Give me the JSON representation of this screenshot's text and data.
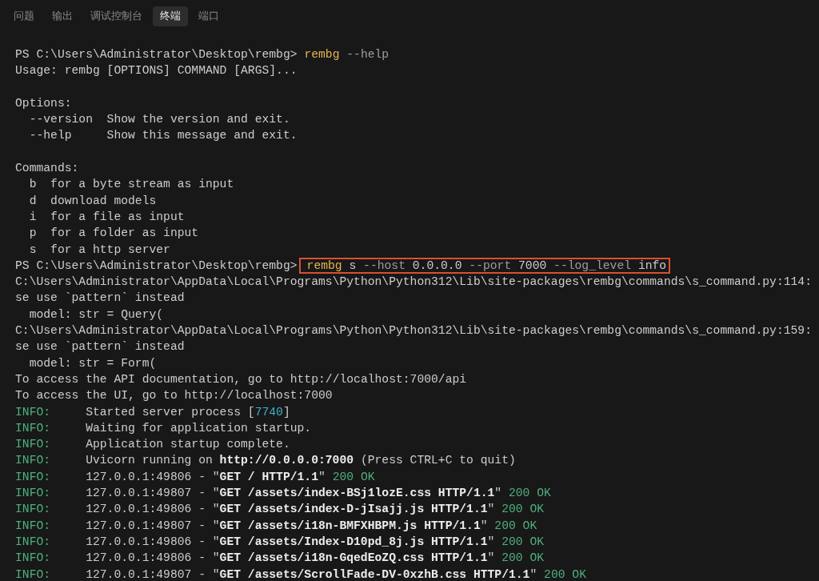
{
  "tabs": [
    {
      "label": "问题",
      "selected": false
    },
    {
      "label": "输出",
      "selected": false
    },
    {
      "label": "调试控制台",
      "selected": false
    },
    {
      "label": "终端",
      "selected": true
    },
    {
      "label": "端口",
      "selected": false
    }
  ],
  "terminal": {
    "lines": [
      {
        "kind": "prompt",
        "prompt": "PS C:\\Users\\Administrator\\Desktop\\rembg>",
        "highlighted": false,
        "segments": [
          {
            "text": " rembg",
            "kind": "command"
          },
          {
            "text": " --help",
            "kind": "flag"
          }
        ]
      },
      {
        "kind": "text",
        "text": "Usage: rembg [OPTIONS] COMMAND [ARGS]..."
      },
      {
        "kind": "blank"
      },
      {
        "kind": "text",
        "text": "Options:"
      },
      {
        "kind": "text",
        "text": "  --version  Show the version and exit."
      },
      {
        "kind": "text",
        "text": "  --help     Show this message and exit."
      },
      {
        "kind": "blank"
      },
      {
        "kind": "text",
        "text": "Commands:"
      },
      {
        "kind": "text",
        "text": "  b  for a byte stream as input"
      },
      {
        "kind": "text",
        "text": "  d  download models"
      },
      {
        "kind": "text",
        "text": "  i  for a file as input"
      },
      {
        "kind": "text",
        "text": "  p  for a folder as input"
      },
      {
        "kind": "text",
        "text": "  s  for a http server"
      },
      {
        "kind": "prompt",
        "prompt": "PS C:\\Users\\Administrator\\Desktop\\rembg>",
        "highlighted": true,
        "segments": [
          {
            "text": "rembg",
            "kind": "command"
          },
          {
            "text": " s",
            "kind": "plain"
          },
          {
            "text": " --host",
            "kind": "flag"
          },
          {
            "text": " 0.0.0.0",
            "kind": "plain"
          },
          {
            "text": " --port",
            "kind": "flag"
          },
          {
            "text": " 7000",
            "kind": "plain"
          },
          {
            "text": " --log_level",
            "kind": "flag"
          },
          {
            "text": " info",
            "kind": "plain"
          }
        ]
      },
      {
        "kind": "text",
        "text": "C:\\Users\\Administrator\\AppData\\Local\\Programs\\Python\\Python312\\Lib\\site-packages\\rembg\\commands\\s_command.py:114:"
      },
      {
        "kind": "text",
        "text": "se use `pattern` instead"
      },
      {
        "kind": "text",
        "text": "  model: str = Query("
      },
      {
        "kind": "text",
        "text": "C:\\Users\\Administrator\\AppData\\Local\\Programs\\Python\\Python312\\Lib\\site-packages\\rembg\\commands\\s_command.py:159:"
      },
      {
        "kind": "text",
        "text": "se use `pattern` instead"
      },
      {
        "kind": "text",
        "text": "  model: str = Form("
      },
      {
        "kind": "text",
        "text": "To access the API documentation, go to http://localhost:7000/api"
      },
      {
        "kind": "text",
        "text": "To access the UI, go to http://localhost:7000"
      },
      {
        "kind": "info",
        "label": "INFO:",
        "segments": [
          {
            "text": "Started server process [",
            "kind": "plain"
          },
          {
            "text": "7740",
            "kind": "number"
          },
          {
            "text": "]",
            "kind": "plain"
          }
        ]
      },
      {
        "kind": "info",
        "label": "INFO:",
        "segments": [
          {
            "text": "Waiting for application startup.",
            "kind": "plain"
          }
        ]
      },
      {
        "kind": "info",
        "label": "INFO:",
        "segments": [
          {
            "text": "Application startup complete.",
            "kind": "plain"
          }
        ]
      },
      {
        "kind": "info",
        "label": "INFO:",
        "segments": [
          {
            "text": "Uvicorn running on",
            "kind": "plain"
          },
          {
            "text": " http://0.0.0.0:7000",
            "kind": "bold"
          },
          {
            "text": " (Press CTRL+C to quit)",
            "kind": "plain"
          }
        ]
      },
      {
        "kind": "info",
        "label": "INFO:",
        "segments": [
          {
            "text": "127.0.0.1:49806 - \"",
            "kind": "plain"
          },
          {
            "text": "GET / HTTP/1.1",
            "kind": "bold"
          },
          {
            "text": "\"",
            "kind": "plain"
          },
          {
            "text": " 200 OK",
            "kind": "status"
          }
        ]
      },
      {
        "kind": "info",
        "label": "INFO:",
        "segments": [
          {
            "text": "127.0.0.1:49807 - \"",
            "kind": "plain"
          },
          {
            "text": "GET /assets/index-BSj1lozE.css HTTP/1.1",
            "kind": "bold"
          },
          {
            "text": "\"",
            "kind": "plain"
          },
          {
            "text": " 200 OK",
            "kind": "status"
          }
        ]
      },
      {
        "kind": "info",
        "label": "INFO:",
        "segments": [
          {
            "text": "127.0.0.1:49806 - \"",
            "kind": "plain"
          },
          {
            "text": "GET /assets/index-D-jIsajj.js HTTP/1.1",
            "kind": "bold"
          },
          {
            "text": "\"",
            "kind": "plain"
          },
          {
            "text": " 200 OK",
            "kind": "status"
          }
        ]
      },
      {
        "kind": "info",
        "label": "INFO:",
        "segments": [
          {
            "text": "127.0.0.1:49807 - \"",
            "kind": "plain"
          },
          {
            "text": "GET /assets/i18n-BMFXHBPM.js HTTP/1.1",
            "kind": "bold"
          },
          {
            "text": "\"",
            "kind": "plain"
          },
          {
            "text": " 200 OK",
            "kind": "status"
          }
        ]
      },
      {
        "kind": "info",
        "label": "INFO:",
        "segments": [
          {
            "text": "127.0.0.1:49806 - \"",
            "kind": "plain"
          },
          {
            "text": "GET /assets/Index-D10pd_8j.js HTTP/1.1",
            "kind": "bold"
          },
          {
            "text": "\"",
            "kind": "plain"
          },
          {
            "text": " 200 OK",
            "kind": "status"
          }
        ]
      },
      {
        "kind": "info",
        "label": "INFO:",
        "segments": [
          {
            "text": "127.0.0.1:49806 - \"",
            "kind": "plain"
          },
          {
            "text": "GET /assets/i18n-GqedEoZQ.css HTTP/1.1",
            "kind": "bold"
          },
          {
            "text": "\"",
            "kind": "plain"
          },
          {
            "text": " 200 OK",
            "kind": "status"
          }
        ]
      },
      {
        "kind": "info",
        "label": "INFO:",
        "segments": [
          {
            "text": "127.0.0.1:49807 - \"",
            "kind": "plain"
          },
          {
            "text": "GET /assets/ScrollFade-DV-0xzhB.css HTTP/1.1",
            "kind": "bold"
          },
          {
            "text": "\"",
            "kind": "plain"
          },
          {
            "text": " 200 OK",
            "kind": "status"
          }
        ]
      }
    ]
  }
}
